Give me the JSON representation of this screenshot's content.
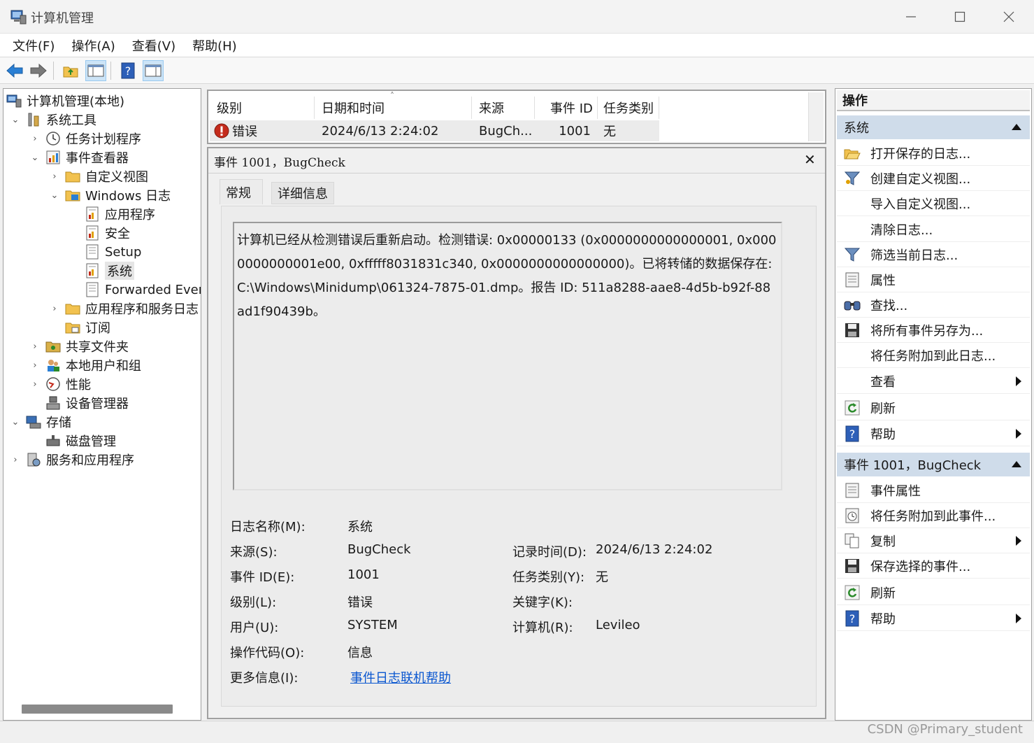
{
  "window": {
    "title": "计算机管理",
    "controls": [
      "minimize-icon",
      "maximize-icon",
      "close-icon"
    ]
  },
  "menu": [
    "文件(F)",
    "操作(A)",
    "查看(V)",
    "帮助(H)"
  ],
  "toolbar": [
    "back-icon",
    "forward-icon",
    "up-folder-icon",
    "console-tree-icon",
    "help-icon",
    "action-pane-icon"
  ],
  "tree": {
    "items": [
      {
        "label": "计算机管理(本地)",
        "icon": "computer-management-icon"
      },
      {
        "label": "系统工具",
        "icon": "tools-icon"
      },
      {
        "label": "任务计划程序",
        "icon": "clock-icon"
      },
      {
        "label": "事件查看器",
        "icon": "event-viewer-icon"
      },
      {
        "label": "自定义视图",
        "icon": "folder-icon"
      },
      {
        "label": "Windows 日志",
        "icon": "folder-windows-icon"
      },
      {
        "label": "应用程序",
        "icon": "log-icon"
      },
      {
        "label": "安全",
        "icon": "log-icon"
      },
      {
        "label": "Setup",
        "icon": "log-icon"
      },
      {
        "label": "系统",
        "icon": "log-icon"
      },
      {
        "label": "Forwarded Even",
        "icon": "log-icon"
      },
      {
        "label": "应用程序和服务日志",
        "icon": "folder-icon"
      },
      {
        "label": "订阅",
        "icon": "subscription-icon"
      },
      {
        "label": "共享文件夹",
        "icon": "shared-folder-icon"
      },
      {
        "label": "本地用户和组",
        "icon": "users-icon"
      },
      {
        "label": "性能",
        "icon": "performance-icon"
      },
      {
        "label": "设备管理器",
        "icon": "device-manager-icon"
      },
      {
        "label": "存储",
        "icon": "storage-icon"
      },
      {
        "label": "磁盘管理",
        "icon": "disk-icon"
      },
      {
        "label": "服务和应用程序",
        "icon": "services-icon"
      }
    ]
  },
  "eventlist": {
    "columns": [
      "级别",
      "日期和时间",
      "来源",
      "事件 ID",
      "任务类别"
    ],
    "row": {
      "level": "错误",
      "datetime": "2024/6/13 2:24:02",
      "source": "BugCh...",
      "event_id": "1001",
      "task": "无"
    }
  },
  "detail": {
    "header": "事件 1001，BugCheck",
    "tabs": [
      "常规",
      "详细信息"
    ],
    "description": "计算机已经从检测错误后重新启动。检测错误: 0x00000133 (0x0000000000000001, 0x0000000000001e00, 0xfffff8031831c340, 0x0000000000000000)。已将转储的数据保存在: C:\\Windows\\Minidump\\061324-7875-01.dmp。报告 ID: 511a8288-aae8-4d5b-b92f-88ad1f90439b。",
    "fields": {
      "log_name_label": "日志名称(M):",
      "log_name": "系统",
      "source_label": "来源(S):",
      "source": "BugCheck",
      "logged_label": "记录时间(D):",
      "logged": "2024/6/13 2:24:02",
      "event_id_label": "事件 ID(E):",
      "event_id": "1001",
      "task_label": "任务类别(Y):",
      "task": "无",
      "level_label": "级别(L):",
      "level": "错误",
      "keywords_label": "关键字(K):",
      "user_label": "用户(U):",
      "user": "SYSTEM",
      "computer_label": "计算机(R):",
      "computer": "Levileo",
      "opcode_label": "操作代码(O):",
      "opcode": "信息",
      "more_info_label": "更多信息(I):",
      "more_info_link": "事件日志联机帮助"
    }
  },
  "actions": {
    "title": "操作",
    "section1": {
      "title": "系统",
      "items": [
        {
          "label": "打开保存的日志...",
          "icon": "open-folder-icon"
        },
        {
          "label": "创建自定义视图...",
          "icon": "filter-icon"
        },
        {
          "label": "导入自定义视图...",
          "icon": ""
        },
        {
          "label": "清除日志...",
          "icon": ""
        },
        {
          "label": "筛选当前日志...",
          "icon": "filter-icon"
        },
        {
          "label": "属性",
          "icon": "properties-icon"
        },
        {
          "label": "查找...",
          "icon": "binoculars-icon"
        },
        {
          "label": "将所有事件另存为...",
          "icon": "save-icon"
        },
        {
          "label": "将任务附加到此日志...",
          "icon": ""
        },
        {
          "label": "查看",
          "icon": "",
          "submenu": true
        },
        {
          "label": "刷新",
          "icon": "refresh-icon"
        },
        {
          "label": "帮助",
          "icon": "help-icon",
          "submenu": true
        }
      ]
    },
    "section2": {
      "title": "事件 1001，BugCheck",
      "items": [
        {
          "label": "事件属性",
          "icon": "properties-icon"
        },
        {
          "label": "将任务附加到此事件...",
          "icon": "task-icon"
        },
        {
          "label": "复制",
          "icon": "copy-icon",
          "submenu": true
        },
        {
          "label": "保存选择的事件...",
          "icon": "save-icon"
        },
        {
          "label": "刷新",
          "icon": "refresh-icon"
        },
        {
          "label": "帮助",
          "icon": "help-icon",
          "submenu": true
        }
      ]
    }
  },
  "watermark": "CSDN @Primary_student",
  "colors": {
    "selection": "#cfdcea",
    "link": "#0b57d0",
    "error": "#c42b1c"
  }
}
